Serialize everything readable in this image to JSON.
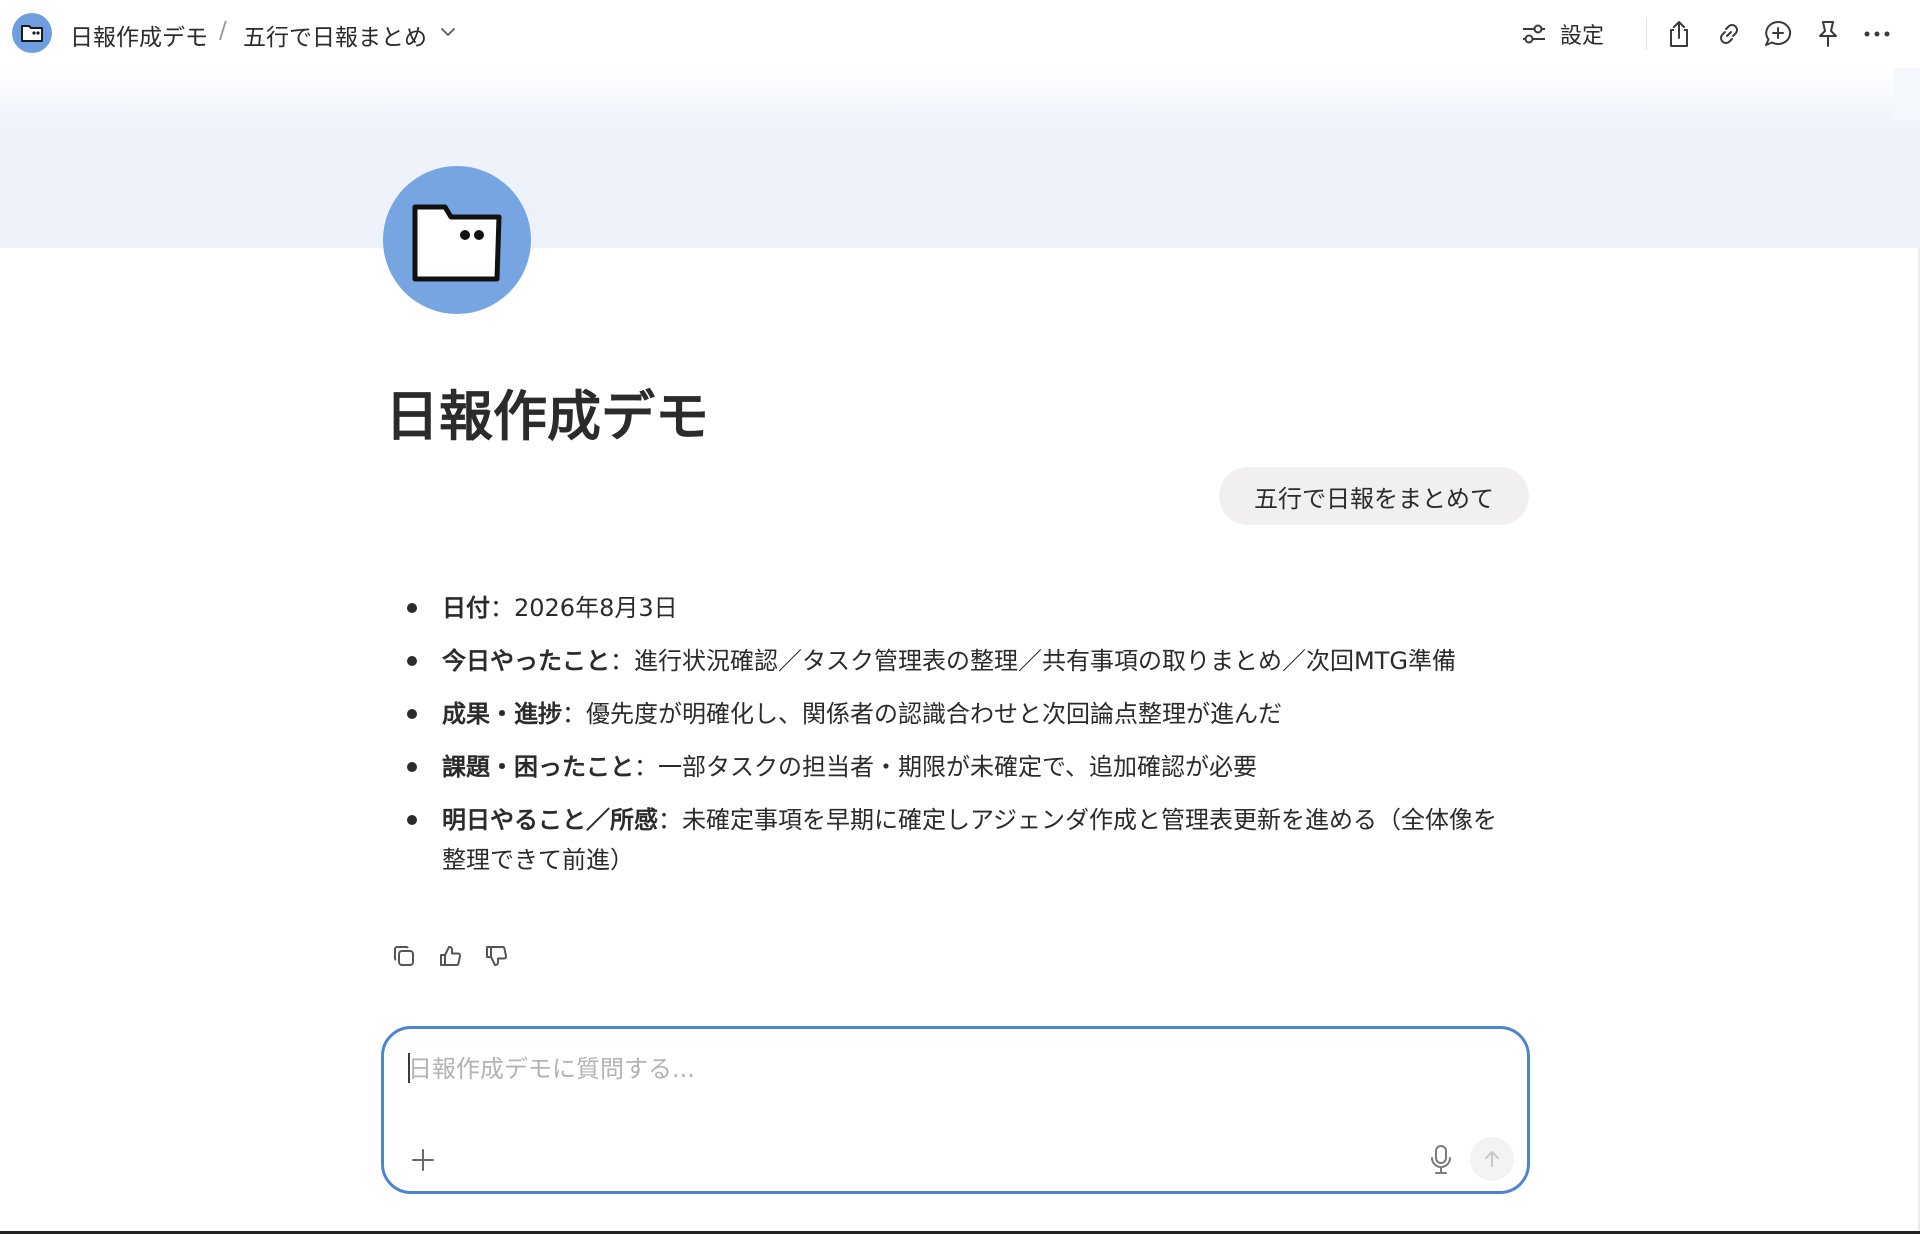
{
  "header": {
    "space_name": "日報作成デモ",
    "separator": "/",
    "chat_title": "五行で日報まとめ",
    "settings_label": "設定"
  },
  "page": {
    "title": "日報作成デモ"
  },
  "conversation": {
    "user_message": "五行で日報をまとめて",
    "answer": [
      {
        "label": "日付",
        "text": "：2026年8月3日"
      },
      {
        "label": "今日やったこと",
        "text": "：進行状況確認／タスク管理表の整理／共有事項の取りまとめ／次回MTG準備"
      },
      {
        "label": "成果・進捗",
        "text": "：優先度が明確化し、関係者の認識合わせと次回論点整理が進んだ"
      },
      {
        "label": "課題・困ったこと",
        "text": "：一部タスクの担当者・期限が未確定で、追加確認が必要"
      },
      {
        "label": "明日やること／所感",
        "text": "：未確定事項を早期に確定しアジェンダ作成と管理表更新を進める（全体像を整理できて前進）"
      }
    ]
  },
  "composer": {
    "placeholder": "日報作成デモに質問する...",
    "value": ""
  },
  "colors": {
    "accent": "#4d84d1",
    "avatar": "#77a5e2",
    "banner": "#edf2fa",
    "user_bubble": "#f1f0ee"
  },
  "icons": [
    "folder-icon",
    "chevron-down-icon",
    "settings-sliders-icon",
    "share-icon",
    "link-icon",
    "comment-add-icon",
    "pin-icon",
    "more-icon",
    "copy-icon",
    "thumbs-up-icon",
    "thumbs-down-icon",
    "plus-icon",
    "microphone-icon",
    "arrow-up-icon"
  ]
}
